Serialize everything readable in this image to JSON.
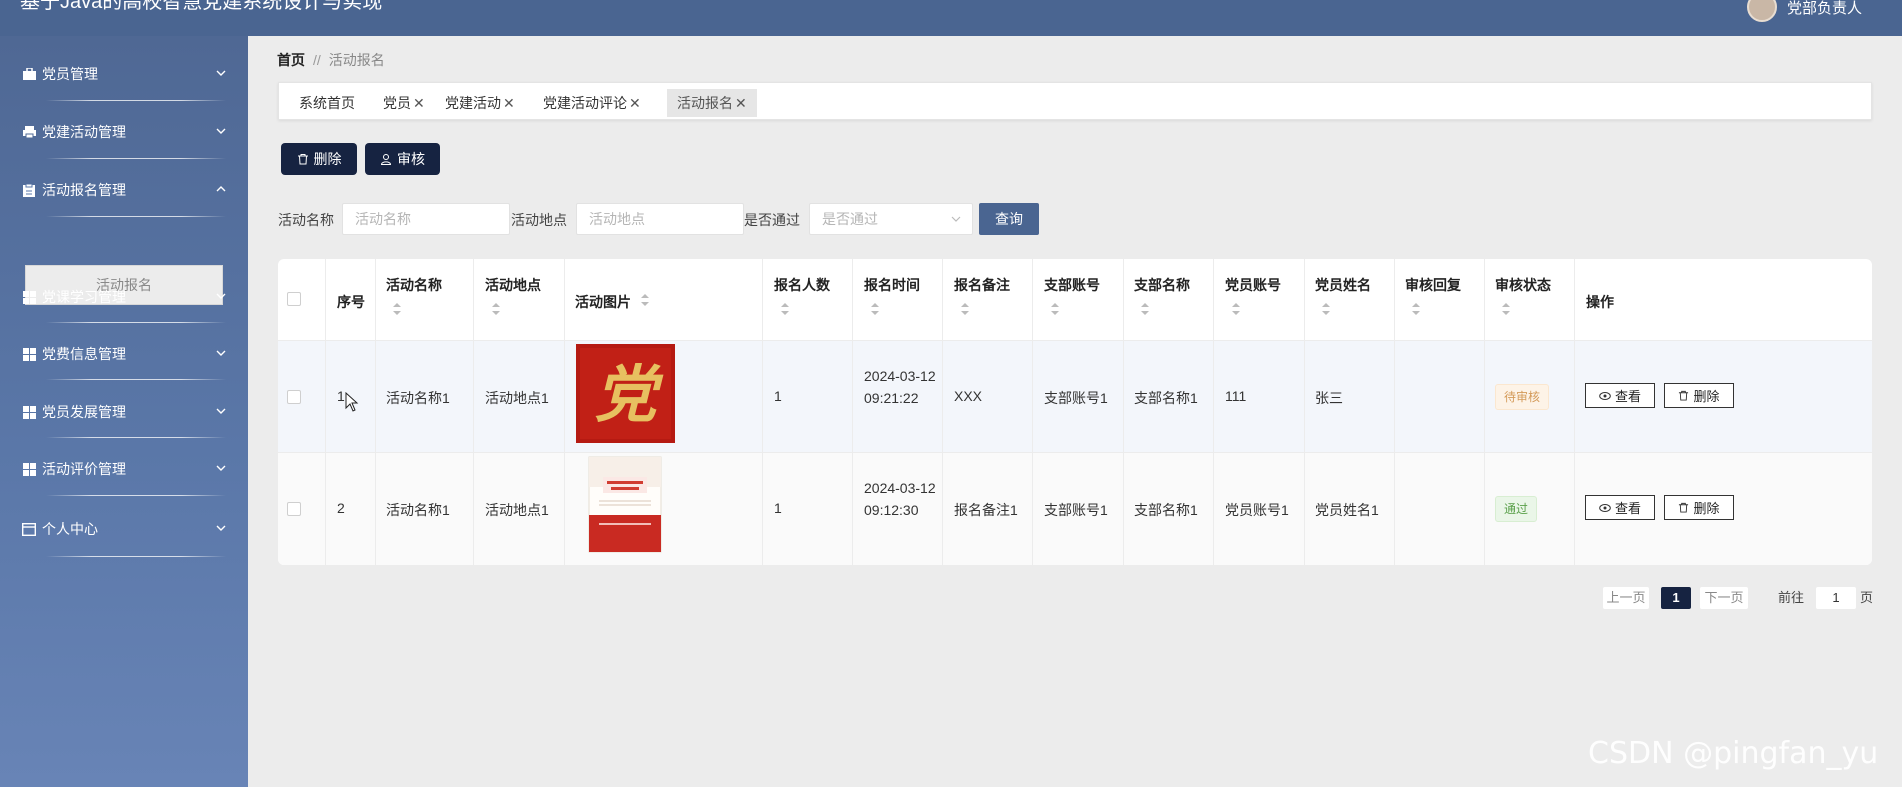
{
  "header": {
    "title": "基于Java的高校智慧党建系统设计与实现",
    "user": "党部负责人"
  },
  "sidebar": {
    "items": [
      {
        "label": "党员管理",
        "icon": "briefcase-icon",
        "open": false
      },
      {
        "label": "党建活动管理",
        "icon": "printer-icon",
        "open": false
      },
      {
        "label": "活动报名管理",
        "icon": "clipboard-icon",
        "open": true
      },
      {
        "label": "党课学习管理",
        "icon": "grid-icon",
        "open": false
      },
      {
        "label": "党费信息管理",
        "icon": "grid-icon",
        "open": false
      },
      {
        "label": "党员发展管理",
        "icon": "grid-icon",
        "open": false
      },
      {
        "label": "活动评价管理",
        "icon": "grid-icon",
        "open": false
      },
      {
        "label": "个人中心",
        "icon": "calendar-icon",
        "open": false
      }
    ],
    "submenu_active": "活动报名"
  },
  "breadcrumb": {
    "home": "首页",
    "separator": "//",
    "current": "活动报名"
  },
  "tabs": [
    {
      "label": "系统首页",
      "closable": false
    },
    {
      "label": "党员",
      "closable": true
    },
    {
      "label": "党建活动",
      "closable": true
    },
    {
      "label": "党建活动评论",
      "closable": true
    },
    {
      "label": "活动报名",
      "closable": true,
      "active": true
    }
  ],
  "actions": {
    "delete": "删除",
    "audit": "审核"
  },
  "search": {
    "activity_name_label": "活动名称",
    "activity_name_placeholder": "活动名称",
    "location_label": "活动地点",
    "location_placeholder": "活动地点",
    "passed_label": "是否通过",
    "passed_placeholder": "是否通过",
    "query_button": "查询"
  },
  "table": {
    "columns": [
      "序号",
      "活动名称",
      "活动地点",
      "活动图片",
      "报名人数",
      "报名时间",
      "报名备注",
      "支部账号",
      "支部名称",
      "党员账号",
      "党员姓名",
      "审核回复",
      "审核状态",
      "操作"
    ],
    "rows": [
      {
        "index": "1",
        "name": "活动名称1",
        "location": "活动地点1",
        "image": "party-character-image",
        "count": "1",
        "time": "2024-03-12 09:21:22",
        "remark": "XXX",
        "branch_account": "支部账号1",
        "branch_name": "支部名称1",
        "member_account": "111",
        "member_name": "张三",
        "reply": "",
        "status": "待审核",
        "view": "查看",
        "delete": "删除"
      },
      {
        "index": "2",
        "name": "活动名称1",
        "location": "活动地点1",
        "image": "book-cover-image",
        "count": "1",
        "time": "2024-03-12 09:12:30",
        "remark": "报名备注1",
        "branch_account": "支部账号1",
        "branch_name": "支部名称1",
        "member_account": "党员账号1",
        "member_name": "党员姓名1",
        "reply": "",
        "status": "通过",
        "view": "查看",
        "delete": "删除"
      }
    ]
  },
  "pagination": {
    "prev": "上一页",
    "current": "1",
    "next": "下一页",
    "goto": "前往",
    "goto_value": "1",
    "page_unit": "页"
  },
  "watermark": "CSDN @pingfan_yu",
  "colors": {
    "topbar": "#4a6591",
    "dark_button": "#162341",
    "query_button": "#4a6591",
    "pending": "#d49b5a",
    "pass": "#5aa04a"
  }
}
